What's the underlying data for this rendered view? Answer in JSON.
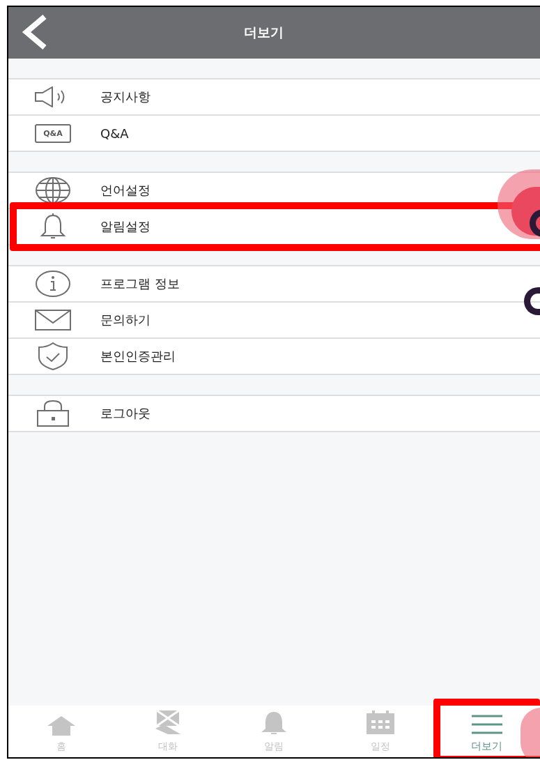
{
  "header": {
    "title": "더보기"
  },
  "menu_groups": [
    {
      "items": [
        {
          "label": "공지사항",
          "highlighted": false
        },
        {
          "label": "Q&A",
          "highlighted": false,
          "icon_text": "Q&A"
        }
      ]
    },
    {
      "items": [
        {
          "label": "언어설정",
          "highlighted": false
        },
        {
          "label": "알림설정",
          "highlighted": true
        }
      ]
    },
    {
      "items": [
        {
          "label": "프로그램 정보",
          "highlighted": false
        },
        {
          "label": "문의하기",
          "highlighted": false
        },
        {
          "label": "본인인증관리",
          "highlighted": false
        }
      ]
    },
    {
      "items": [
        {
          "label": "로그아웃",
          "highlighted": false
        }
      ]
    }
  ],
  "tab_bar": [
    {
      "label": "홈",
      "selected": false,
      "highlighted": false
    },
    {
      "label": "대화",
      "selected": false,
      "highlighted": false
    },
    {
      "label": "알림",
      "selected": false,
      "highlighted": false
    },
    {
      "label": "일정",
      "selected": false,
      "highlighted": false
    },
    {
      "label": "더보기",
      "selected": true,
      "highlighted": true
    }
  ]
}
